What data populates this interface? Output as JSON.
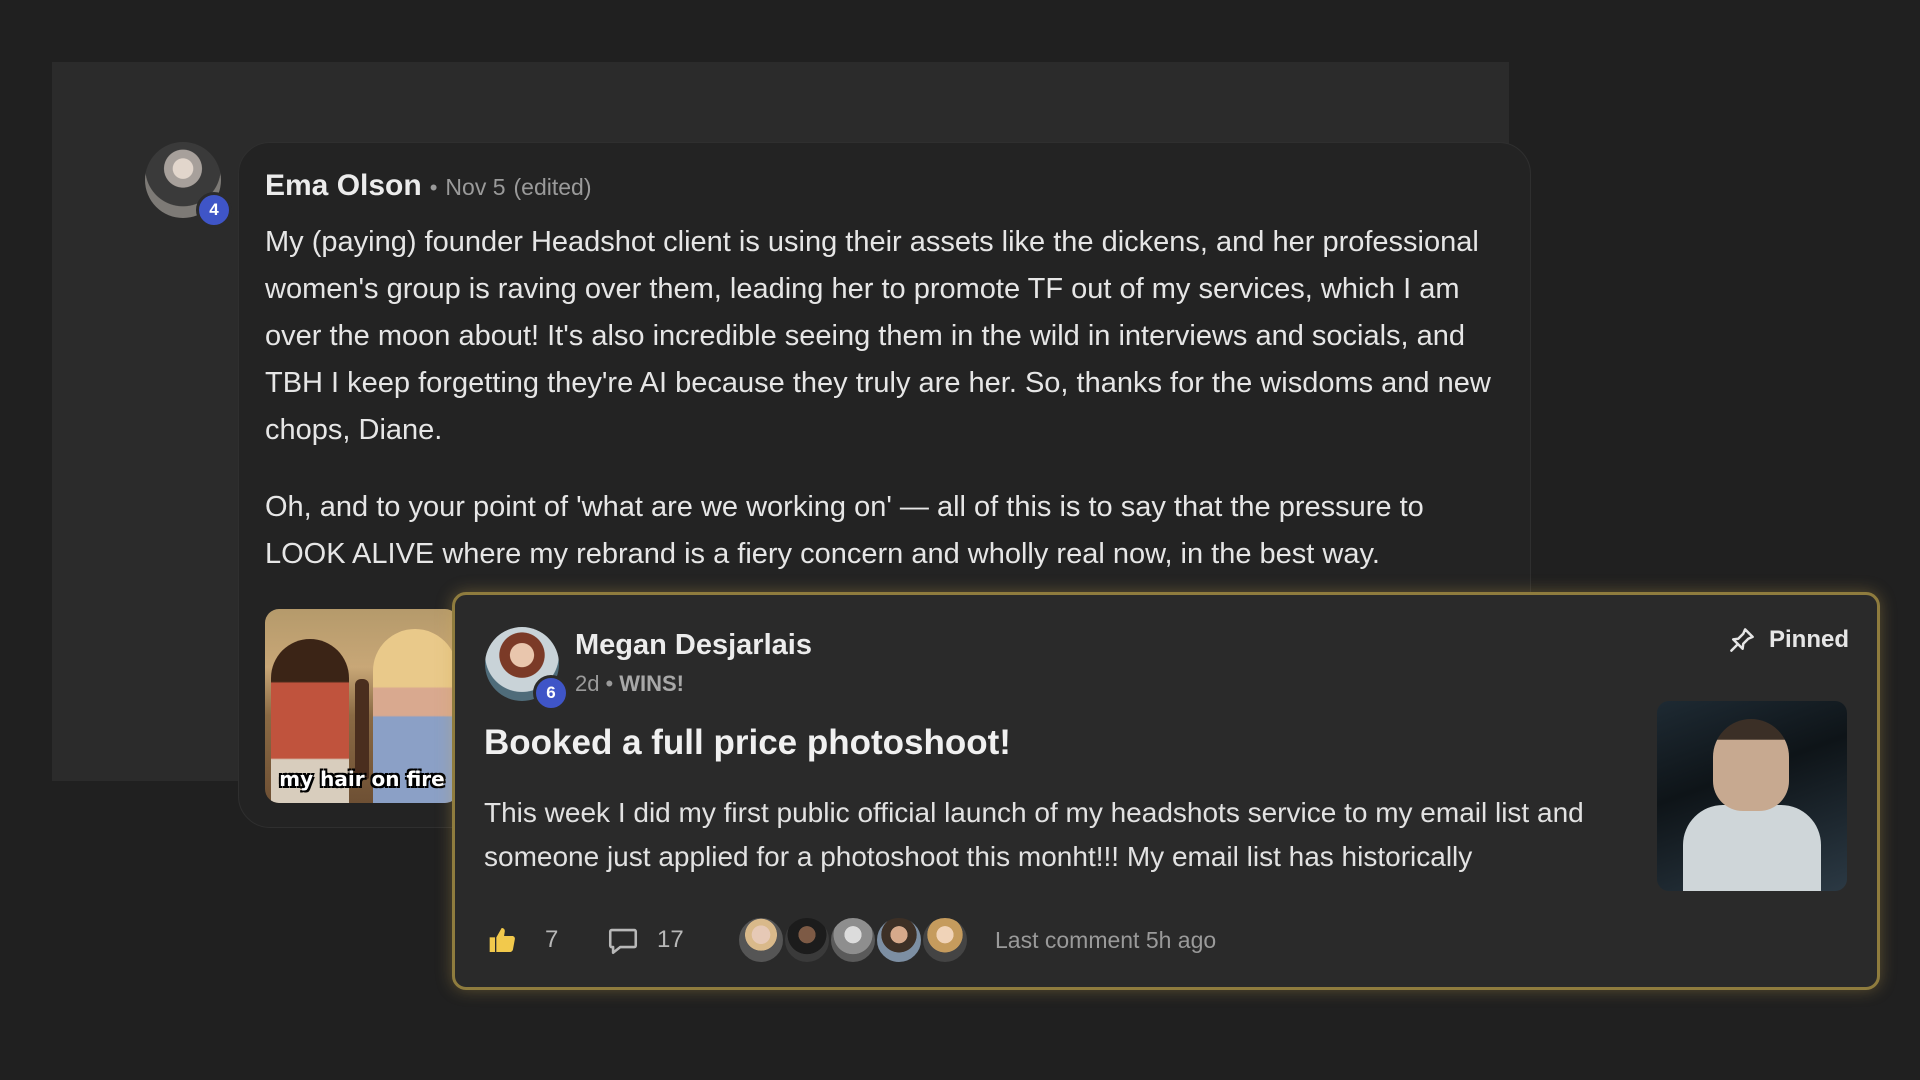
{
  "comment": {
    "author": "Ema Olson",
    "separator": "•",
    "date": "Nov 5",
    "edited": "(edited)",
    "level": "4",
    "paragraphs": [
      "My (paying) founder Headshot client is using their assets like the dickens, and her professional women's group is raving over them, leading her to promote TF out of my services, which I am over the moon about! It's also incredible seeing them in the wild in interviews and socials, and TBH I keep forgetting they're AI because they truly are her. So, thanks for the wisdoms and new chops, Diane.",
      "Oh, and to your point of 'what are we working on' — all of this is to say that the pressure to LOOK ALIVE where my rebrand is a fiery concern and wholly real now, in the best way."
    ],
    "gif_caption": "my hair on fire"
  },
  "post": {
    "author": "Megan Desjarlais",
    "level": "6",
    "time": "2d",
    "separator": "•",
    "category": "WINS!",
    "pinned_label": "Pinned",
    "title": "Booked a full price photoshoot!",
    "excerpt": "This week I did my first public official launch of my headshots service to my email list and someone just applied for a photoshoot this monht!!! My email list has historically",
    "likes": "7",
    "comments": "17",
    "last_comment": "Last comment 5h ago",
    "participant_count": 5
  },
  "colors": {
    "background": "#202020",
    "badge": "#3f55c7",
    "pinned_border": "#8f7c3e"
  },
  "icons": [
    "pin-icon",
    "thumbs-up-icon",
    "comment-bubble-icon"
  ]
}
